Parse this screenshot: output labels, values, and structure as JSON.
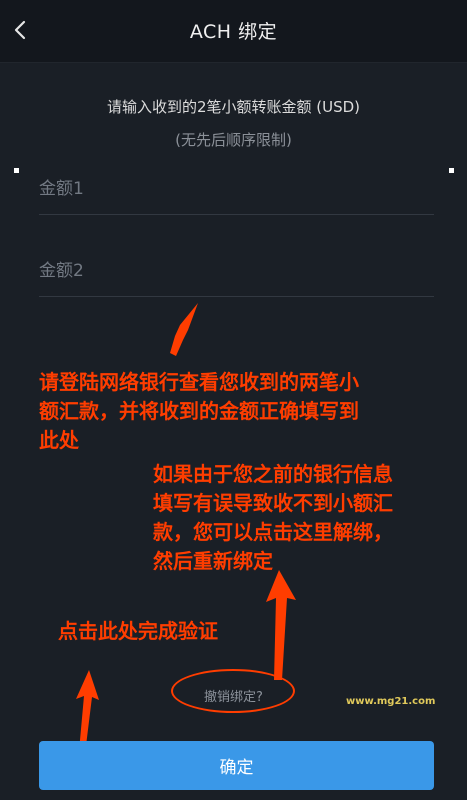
{
  "header": {
    "title": "ACH 绑定",
    "back_icon": "chevron-left-icon"
  },
  "form": {
    "instruction": "请输入收到的2笔小额转账金额 (USD)",
    "sub_instruction": "(无先后顺序限制)",
    "amount1_placeholder": "金额1",
    "amount1_value": "",
    "amount2_placeholder": "金额2",
    "amount2_value": ""
  },
  "annotations": {
    "note1_line1": "请登陆网络银行查看您收到的两笔小",
    "note1_line2": "额汇款，并将收到的金额正确填写到",
    "note1_line3": "此处",
    "note2_line1": "如果由于您之前的银行信息",
    "note2_line2": "填写有误导致收不到小额汇",
    "note2_line3": "款，您可以点击这里解绑，",
    "note2_line4": "然后重新绑定",
    "note3": "点击此处完成验证",
    "color": "#ff3d00"
  },
  "unbind_link": "撤销绑定?",
  "watermark": "www.mg21.com",
  "confirm_button": "确定",
  "colors": {
    "background": "#1a1f26",
    "header": "#13171d",
    "button": "#3a98e8",
    "annotation": "#ff3d00"
  }
}
